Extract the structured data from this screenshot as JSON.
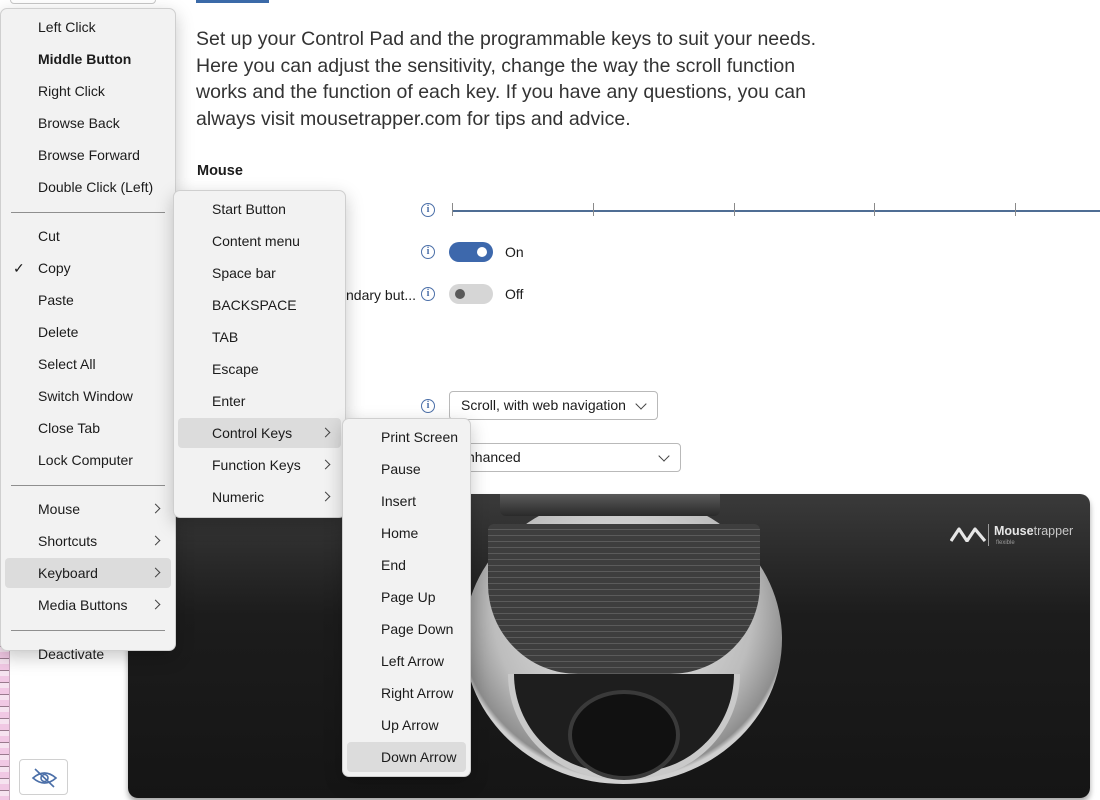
{
  "intro": {
    "lines": [
      "Set up your Control Pad and the programmable keys to suit your needs.",
      "Here you can adjust the sensitivity, change the way the scroll function",
      "works and the function of each key. If you have any questions, you can",
      "always visit mousetrapper.com for tips and advice."
    ]
  },
  "mouse_section": {
    "heading": "Mouse",
    "toggle1": {
      "state": "On",
      "checked": true
    },
    "toggle2": {
      "label_partial": "ndary but...",
      "state": "Off",
      "checked": false
    },
    "scroll_select": {
      "value": "Scroll, with web navigation"
    },
    "mode_select": {
      "value": "nhanced"
    }
  },
  "device": {
    "brand_bold": "Mouse",
    "brand_light": "trapper",
    "brand_sub": "flexible"
  },
  "main_menu": {
    "items": [
      {
        "label": "Left Click"
      },
      {
        "label": "Middle Button",
        "bold": true
      },
      {
        "label": "Right Click"
      },
      {
        "label": "Browse Back"
      },
      {
        "label": "Browse Forward"
      },
      {
        "label": "Double Click (Left)"
      },
      {
        "separator": true
      },
      {
        "label": "Cut"
      },
      {
        "label": "Copy",
        "checked": true,
        "check_glyph": "✓"
      },
      {
        "label": "Paste"
      },
      {
        "label": "Delete"
      },
      {
        "label": "Select All"
      },
      {
        "label": "Switch Window"
      },
      {
        "label": "Close Tab"
      },
      {
        "label": "Lock Computer"
      },
      {
        "separator": true
      },
      {
        "label": "Mouse",
        "submenu": true
      },
      {
        "label": "Shortcuts",
        "submenu": true
      },
      {
        "label": "Keyboard",
        "submenu": true,
        "highlighted": true
      },
      {
        "label": "Media Buttons",
        "submenu": true
      },
      {
        "separator": true
      },
      {
        "label": "Deactivate"
      }
    ]
  },
  "keyboard_menu": {
    "items": [
      {
        "label": "Start Button"
      },
      {
        "label": "Content menu"
      },
      {
        "label": "Space bar"
      },
      {
        "label": "BACKSPACE"
      },
      {
        "label": "TAB"
      },
      {
        "label": "Escape"
      },
      {
        "label": "Enter"
      },
      {
        "label": "Control Keys",
        "submenu": true,
        "highlighted": true
      },
      {
        "label": "Function Keys",
        "submenu": true
      },
      {
        "label": "Numeric",
        "submenu": true
      }
    ]
  },
  "control_keys_menu": {
    "items": [
      {
        "label": "Print Screen"
      },
      {
        "label": "Pause"
      },
      {
        "label": "Insert"
      },
      {
        "label": "Home"
      },
      {
        "label": "End"
      },
      {
        "label": "Page Up"
      },
      {
        "label": "Page Down"
      },
      {
        "label": "Left Arrow"
      },
      {
        "label": "Right Arrow"
      },
      {
        "label": "Up Arrow"
      },
      {
        "label": "Down Arrow",
        "highlighted": true
      }
    ]
  },
  "colors": {
    "accent": "#3d68ac",
    "menu_bg": "#f2f2f2",
    "menu_highlight": "#dcdcdc"
  }
}
